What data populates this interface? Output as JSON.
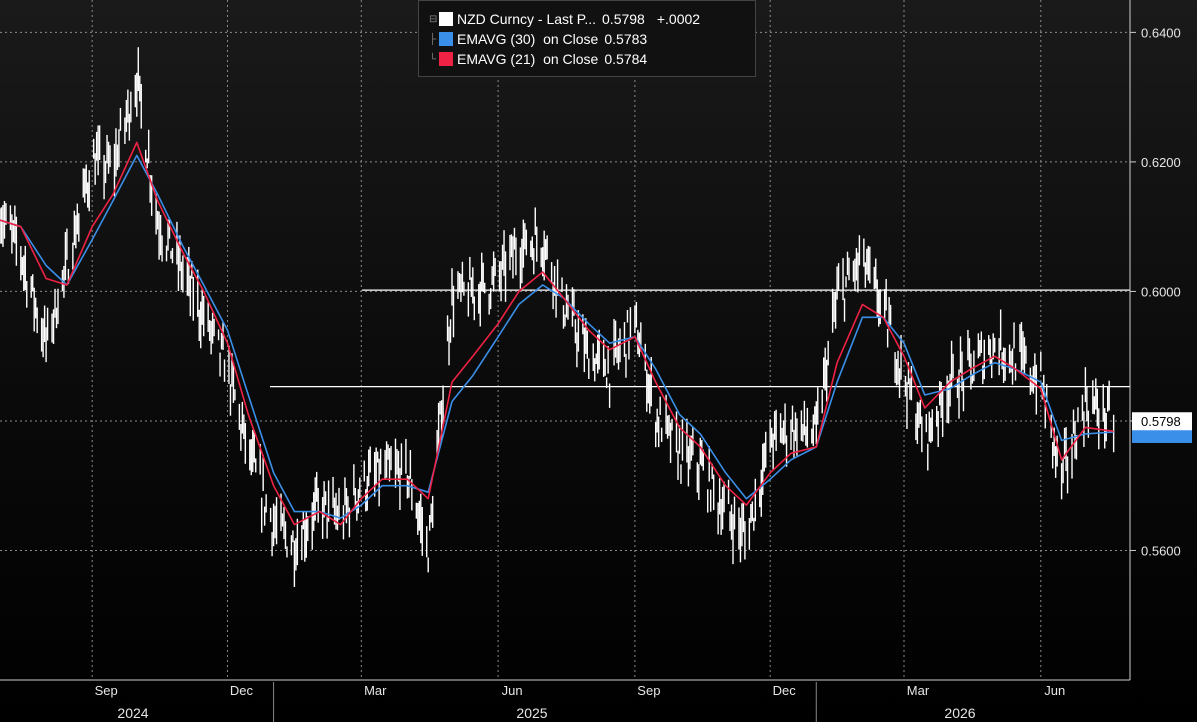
{
  "legend": [
    {
      "name": "NZD Curncy - Last P...",
      "value": "0.5798",
      "change": "+.0002",
      "color": "#ffffff"
    },
    {
      "name": "EMAVG (30)  on Close",
      "value": "0.5783",
      "color": "#3a8fe8"
    },
    {
      "name": "EMAVG (21)  on Close",
      "value": "0.5784",
      "color": "#ee2244"
    }
  ],
  "axes": {
    "y_ticks": [
      "0.6400",
      "0.6200",
      "0.6000",
      "0.5800",
      "0.5600"
    ],
    "y_range": [
      0.54,
      0.645
    ],
    "months": [
      "Sep",
      "Dec",
      "Mar",
      "Jun",
      "Sep",
      "Dec",
      "Mar",
      "Jun"
    ],
    "years": [
      "2024",
      "2025",
      "2026"
    ],
    "last_value_label": "0.5798"
  },
  "colors": {
    "price": "#ffffff",
    "ema30": "#3a8fe8",
    "ema21": "#ee2244",
    "background": "#000000",
    "grid": "#8a8a8a"
  },
  "chart_data": {
    "type": "line",
    "title": "NZD Curncy",
    "x_start": "2024-07-01",
    "x_end": "2026-07-31",
    "ylim": [
      0.54,
      0.645
    ],
    "grid": true,
    "legend_position": "top-center",
    "x": [
      "2024-07-01",
      "2024-07-15",
      "2024-08-01",
      "2024-08-15",
      "2024-09-01",
      "2024-09-15",
      "2024-10-01",
      "2024-10-15",
      "2024-11-01",
      "2024-11-15",
      "2024-12-01",
      "2024-12-15",
      "2025-01-01",
      "2025-01-15",
      "2025-02-01",
      "2025-02-15",
      "2025-03-01",
      "2025-03-15",
      "2025-04-01",
      "2025-04-15",
      "2025-05-01",
      "2025-05-15",
      "2025-06-01",
      "2025-06-15",
      "2025-07-01",
      "2025-07-15",
      "2025-08-01",
      "2025-08-15",
      "2025-09-01",
      "2025-09-15",
      "2025-10-01",
      "2025-10-15",
      "2025-11-01",
      "2025-11-15",
      "2025-12-01",
      "2025-12-15",
      "2026-01-01",
      "2026-01-15",
      "2026-02-01",
      "2026-02-15",
      "2026-03-01",
      "2026-03-15",
      "2026-04-01",
      "2026-04-15",
      "2026-05-01",
      "2026-05-15",
      "2026-06-01",
      "2026-06-15",
      "2026-07-01",
      "2026-07-20"
    ],
    "series": [
      {
        "name": "NZD Curncy - Last P...",
        "values": [
          0.612,
          0.606,
          0.592,
          0.604,
          0.62,
          0.619,
          0.633,
          0.611,
          0.603,
          0.596,
          0.588,
          0.575,
          0.564,
          0.561,
          0.567,
          0.565,
          0.57,
          0.572,
          0.572,
          0.56,
          0.599,
          0.6,
          0.602,
          0.607,
          0.608,
          0.598,
          0.59,
          0.588,
          0.595,
          0.581,
          0.575,
          0.573,
          0.566,
          0.562,
          0.577,
          0.579,
          0.578,
          0.599,
          0.605,
          0.597,
          0.587,
          0.577,
          0.586,
          0.588,
          0.592,
          0.59,
          0.586,
          0.571,
          0.583,
          0.5798
        ]
      },
      {
        "name": "EMAVG (30)  on Close",
        "values": [
          0.611,
          0.61,
          0.604,
          0.601,
          0.608,
          0.614,
          0.621,
          0.615,
          0.607,
          0.601,
          0.594,
          0.584,
          0.572,
          0.566,
          0.566,
          0.565,
          0.567,
          0.57,
          0.57,
          0.569,
          0.583,
          0.587,
          0.593,
          0.598,
          0.601,
          0.599,
          0.595,
          0.592,
          0.593,
          0.588,
          0.581,
          0.578,
          0.572,
          0.568,
          0.571,
          0.574,
          0.576,
          0.586,
          0.596,
          0.596,
          0.592,
          0.584,
          0.585,
          0.587,
          0.589,
          0.588,
          0.586,
          0.577,
          0.578,
          0.5783
        ]
      },
      {
        "name": "EMAVG (21)  on Close",
        "values": [
          0.611,
          0.61,
          0.602,
          0.601,
          0.61,
          0.615,
          0.623,
          0.614,
          0.606,
          0.6,
          0.592,
          0.581,
          0.57,
          0.564,
          0.566,
          0.564,
          0.568,
          0.571,
          0.571,
          0.568,
          0.586,
          0.59,
          0.595,
          0.6,
          0.603,
          0.599,
          0.594,
          0.591,
          0.593,
          0.586,
          0.579,
          0.576,
          0.57,
          0.567,
          0.572,
          0.575,
          0.576,
          0.589,
          0.598,
          0.596,
          0.59,
          0.582,
          0.586,
          0.588,
          0.59,
          0.588,
          0.585,
          0.574,
          0.579,
          0.5784
        ]
      }
    ],
    "hlines": [
      0.6002,
      0.5853
    ]
  }
}
